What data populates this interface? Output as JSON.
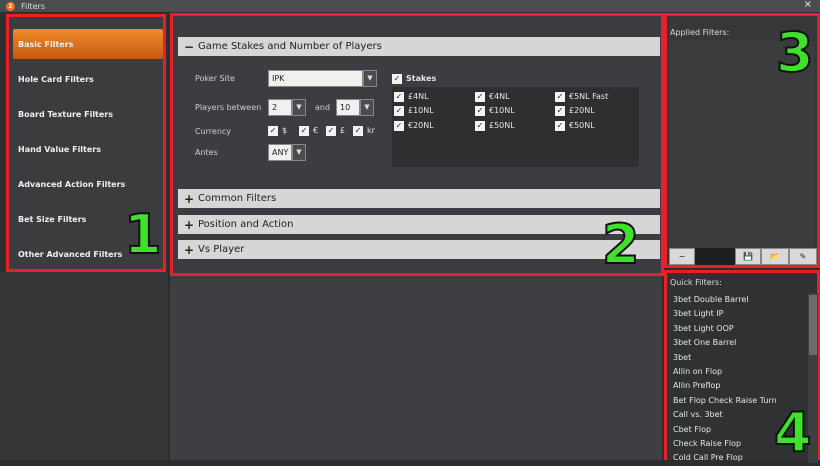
{
  "window": {
    "title": "Filters",
    "close_symbol": "×",
    "app_icon_letter": "2"
  },
  "sidebar": {
    "items": [
      {
        "label": "Basic Filters",
        "active": true
      },
      {
        "label": "Hole Card Filters",
        "active": false
      },
      {
        "label": "Board Texture Filters",
        "active": false
      },
      {
        "label": "Hand Value Filters",
        "active": false
      },
      {
        "label": "Advanced Action Filters",
        "active": false
      },
      {
        "label": "Bet Size Filters",
        "active": false
      },
      {
        "label": "Other Advanced Filters",
        "active": false
      }
    ]
  },
  "center": {
    "sections": [
      {
        "label": "Game Stakes and Number of Players",
        "symbol": "−",
        "expanded": true
      },
      {
        "label": "Common Filters",
        "symbol": "+",
        "expanded": false
      },
      {
        "label": "Position and Action",
        "symbol": "+",
        "expanded": false
      },
      {
        "label": "Vs Player",
        "symbol": "+",
        "expanded": false
      }
    ],
    "poker_site": {
      "label": "Poker Site",
      "value": "IPK"
    },
    "players_between": {
      "label": "Players between",
      "min": "2",
      "and_label": "and",
      "max": "10"
    },
    "currency": {
      "label": "Currency",
      "options": [
        {
          "label": "$",
          "checked": true
        },
        {
          "label": "€",
          "checked": true
        },
        {
          "label": "£",
          "checked": true
        },
        {
          "label": "kr",
          "checked": true
        }
      ]
    },
    "antes": {
      "label": "Antes",
      "value": "ANY"
    },
    "stakes": {
      "label": "Stakes",
      "checked": true,
      "items": [
        {
          "label": "£4NL",
          "checked": true
        },
        {
          "label": "€4NL",
          "checked": true
        },
        {
          "label": "€5NL Fast",
          "checked": true
        },
        {
          "label": "£10NL",
          "checked": true
        },
        {
          "label": "€10NL",
          "checked": true
        },
        {
          "label": "£20NL",
          "checked": true
        },
        {
          "label": "€20NL",
          "checked": true
        },
        {
          "label": "£50NL",
          "checked": true
        },
        {
          "label": "€50NL",
          "checked": true
        }
      ]
    },
    "check_symbol": "✓",
    "dropdown_symbol": "▼"
  },
  "applied": {
    "title": "Applied Filters:",
    "toolbar": {
      "remove": "−",
      "save": "💾",
      "load": "📂",
      "edit": "✎"
    }
  },
  "quick_filters": {
    "title": "Quick Filters:",
    "items": [
      "3bet Double Barrel",
      "3bet Light IP",
      "3bet Light OOP",
      "3bet One Barrel",
      "3bet",
      "Allin on Flop",
      "Allin Preflop",
      "Bet Flop Check Raise Turn",
      "Call vs. 3bet",
      "Cbet Flop",
      "Check Raise Flop",
      "Cold Call Pre Flop"
    ]
  },
  "annotations": [
    "1",
    "2",
    "3",
    "4"
  ],
  "colors": {
    "accent": "#e8742a",
    "highlight_border": "#e8202a",
    "annotation_green": "#3ee22a"
  }
}
